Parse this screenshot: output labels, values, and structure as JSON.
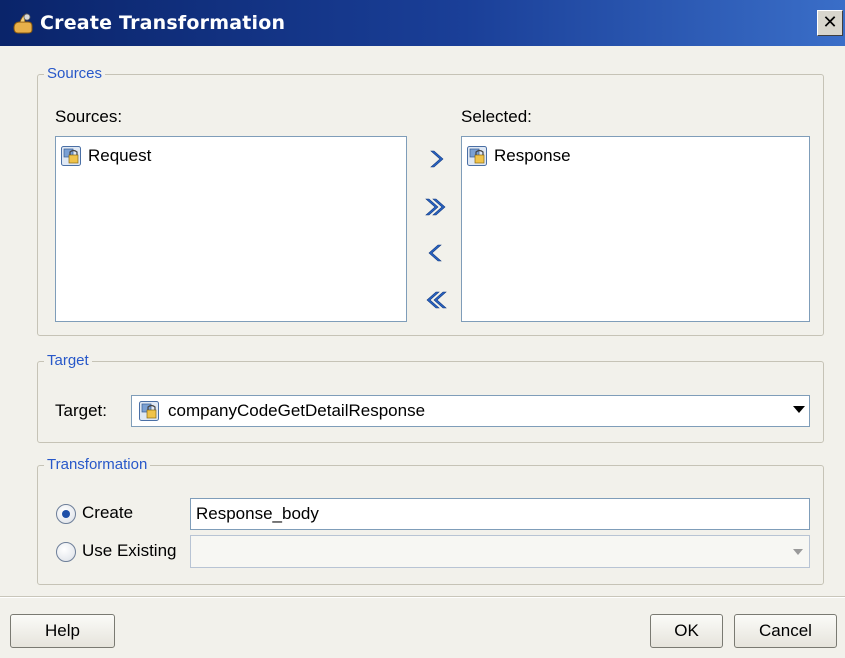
{
  "window": {
    "title": "Create Transformation",
    "close_glyph": "✕"
  },
  "sources_group": {
    "title": "Sources",
    "sources_label": "Sources:",
    "selected_label": "Selected:",
    "sources_items": [
      {
        "label": "Request",
        "icon": "message-part-icon"
      }
    ],
    "selected_items": [
      {
        "label": "Response",
        "icon": "message-part-icon"
      }
    ],
    "arrow_buttons": [
      {
        "name": "move-right-button",
        "glyph": "single-right-chevron"
      },
      {
        "name": "move-all-right-button",
        "glyph": "double-right-chevron"
      },
      {
        "name": "move-left-button",
        "glyph": "single-left-chevron"
      },
      {
        "name": "move-all-left-button",
        "glyph": "double-left-chevron"
      }
    ]
  },
  "target_group": {
    "title": "Target",
    "label": "Target:",
    "selected_value": "companyCodeGetDetailResponse",
    "icon": "message-part-icon"
  },
  "transformation_group": {
    "title": "Transformation",
    "create_label": "Create",
    "create_value": "Response_body",
    "use_existing_label": "Use Existing",
    "use_existing_value": "",
    "selected_option": "Create"
  },
  "buttons": {
    "help": "Help",
    "ok": "OK",
    "cancel": "Cancel"
  },
  "colors": {
    "title_bar": "#0a246a",
    "group_title": "#2858c9",
    "arrow": "#1f59b8",
    "background": "#f2f1eb"
  }
}
